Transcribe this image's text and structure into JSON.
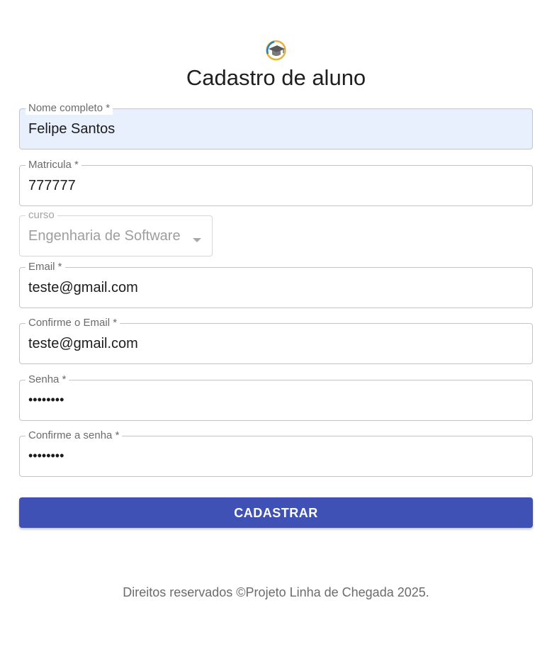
{
  "header": {
    "logo_icon": "graduation-cap-icon",
    "title": "Cadastro de aluno"
  },
  "form": {
    "nome": {
      "label": "Nome completo *",
      "value": "Felipe Santos"
    },
    "matricula": {
      "label": "Matricula *",
      "value": "777777"
    },
    "curso": {
      "label": "curso",
      "value": "Engenharia de Software"
    },
    "email": {
      "label": "Email *",
      "value": "teste@gmail.com"
    },
    "confirm_email": {
      "label": "Confirme o Email *",
      "value": "teste@gmail.com"
    },
    "senha": {
      "label": "Senha *",
      "value": "••••••••"
    },
    "confirm_senha": {
      "label": "Confirme a senha *",
      "value": "••••••••"
    },
    "submit_label": "CADASTRAR"
  },
  "footer": {
    "text": "Direitos reservados ©Projeto Linha de Chegada 2025."
  },
  "colors": {
    "primary": "#3f51b5",
    "autofill_bg": "#e8f0fe",
    "border": "#c4c4c4"
  }
}
